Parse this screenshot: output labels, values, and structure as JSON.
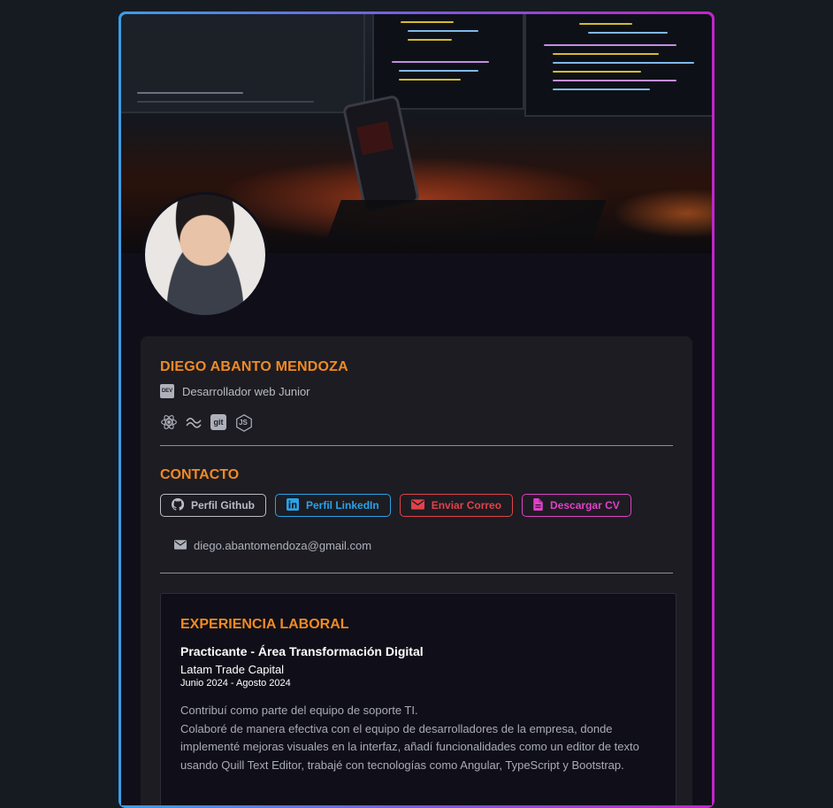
{
  "profile": {
    "name": "DIEGO ABANTO MENDOZA",
    "role": "Desarrollador web Junior",
    "role_icon_text": "DEV",
    "tech_icons": [
      "react-icon",
      "tailwind-icon",
      "git-icon",
      "nodejs-icon"
    ],
    "git_icon_text": "git",
    "js_icon_text": "JS"
  },
  "contact": {
    "title": "CONTACTO",
    "github_label": "Perfil Github",
    "linkedin_label": "Perfil LinkedIn",
    "email_label": "Enviar Correo",
    "cv_label": "Descargar CV",
    "email_address": "diego.abantomendoza@gmail.com"
  },
  "experience": {
    "title": "EXPERIENCIA LABORAL",
    "job_title": "Practicante - Área Transformación Digital",
    "company": "Latam Trade Capital",
    "dates": "Junio 2024 - Agosto 2024",
    "paragraph_1": "Contribuí como parte del equipo de soporte TI.",
    "paragraph_2": "Colaboré de manera efectiva con el equipo de desarrolladores de la empresa, donde implementé mejoras visuales en la interfaz, añadí funcionalidades como un editor de texto usando Quill Text Editor, trabajé con tecnologías como Angular, TypeScript y Bootstrap."
  },
  "colors": {
    "accent": "#f08a24",
    "github": "#b9bcc6",
    "linkedin": "#28a3e8",
    "email": "#e2424a",
    "cv": "#e040c8"
  }
}
